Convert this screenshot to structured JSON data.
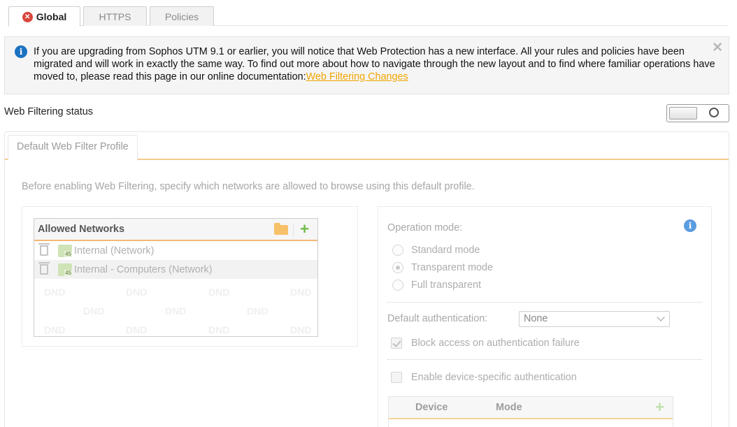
{
  "tabs": [
    {
      "label": "Global",
      "active": true,
      "error_badge": "✕"
    },
    {
      "label": "HTTPS",
      "active": false
    },
    {
      "label": "Policies",
      "active": false
    }
  ],
  "banner": {
    "text": "If you are upgrading from Sophos UTM 9.1 or earlier, you will notice that Web Protection has a new interface. All your rules and policies have been migrated and will work in exactly the same way. To find out more about how to navigate through the new layout and to find where familiar operations have moved to, please read this page in our online documentation:",
    "link_text": "Web Filtering Changes",
    "close_glyph": "✕",
    "icon_glyph": "i"
  },
  "status": {
    "label": "Web Filtering status",
    "enabled": false
  },
  "profile": {
    "tab_label": "Default Web Filter Profile",
    "intro": "Before enabling Web Filtering, specify which networks are allowed to browse using this default profile."
  },
  "allowed_networks": {
    "title": "Allowed Networks",
    "add_glyph": "+",
    "items": [
      {
        "label": "Internal (Network)",
        "badge": "45"
      },
      {
        "label": "Internal - Computers (Network)",
        "badge": "45"
      }
    ],
    "dnd_text": "DND"
  },
  "operation": {
    "label": "Operation mode:",
    "info_glyph": "i",
    "modes": [
      {
        "label": "Standard mode",
        "selected": false
      },
      {
        "label": "Transparent mode",
        "selected": true
      },
      {
        "label": "Full transparent",
        "selected": false
      }
    ]
  },
  "authentication": {
    "label": "Default authentication:",
    "value": "None",
    "block_label": "Block access on authentication failure",
    "block_checked": true,
    "device_label": "Enable device-specific authentication",
    "device_checked": false
  },
  "device_table": {
    "columns": [
      "Device",
      "Mode"
    ],
    "add_glyph": "+"
  },
  "colors": {
    "accent": "#f4b676",
    "link": "#f0a500",
    "info": "#1b72c0",
    "error": "#d9463b"
  }
}
